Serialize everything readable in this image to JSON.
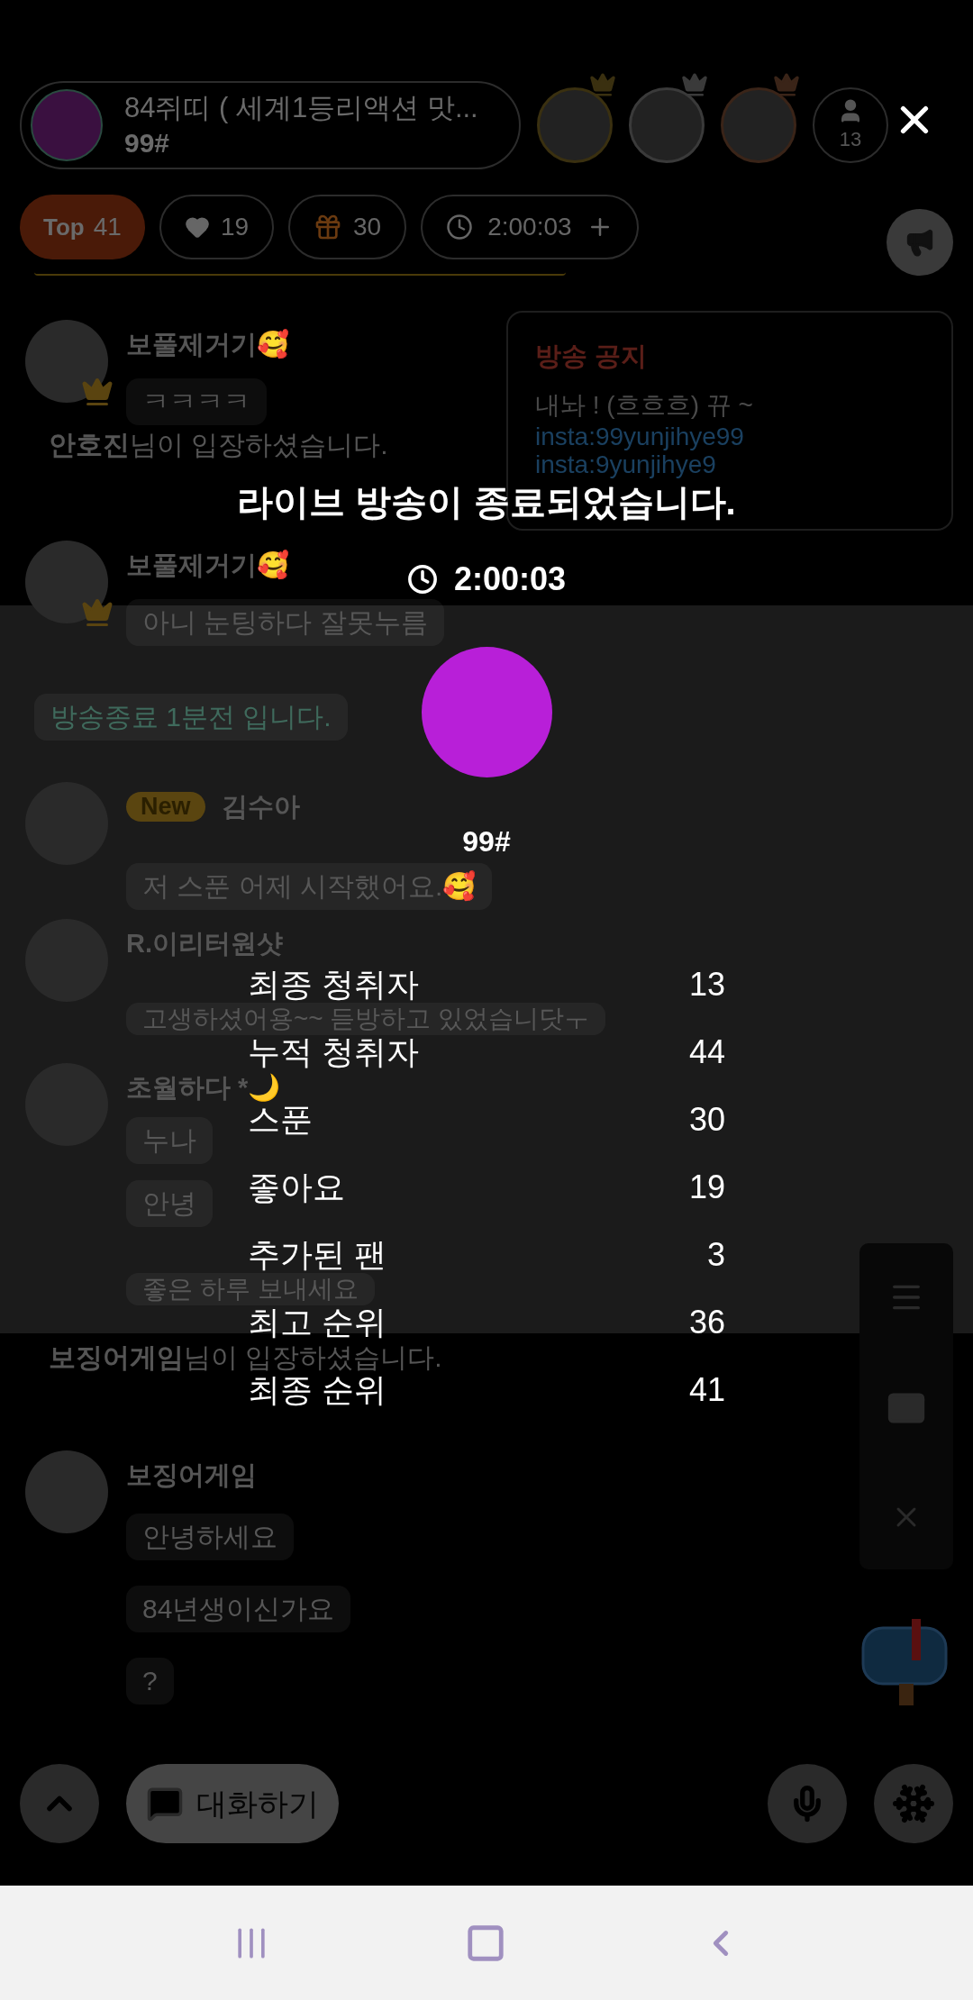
{
  "top_bar": {
    "host_title": "84쥐띠 ( 세계1등리액션 맛...",
    "host_name": "99#",
    "listener_count": "13"
  },
  "stat_chips": {
    "rank_label": "Top",
    "rank": "41",
    "likes": "19",
    "gifts": "30",
    "time": "2:00:03"
  },
  "notice_popup": {
    "title": "방송 공지",
    "text": "내놔 ! (흐흐흐) 뀨 ~",
    "links": [
      "insta:99yunjihye99",
      "insta:9yunjihye9"
    ]
  },
  "chat": [
    {
      "kind": "message",
      "name": "보풀제거기🥰",
      "crown": true,
      "bubbles": [
        "ㅋㅋㅋㅋ"
      ]
    },
    {
      "kind": "join",
      "text": "**안호진**님이 입장하셨습니다."
    },
    {
      "kind": "message",
      "name": "보풀제거기🥰",
      "crown": true,
      "bubbles": [
        "아니 눈팅하다 잘못누름"
      ]
    },
    {
      "kind": "notice",
      "text": "방송종료 1분전 입니다."
    },
    {
      "kind": "message",
      "name": "김수아",
      "badge": "New",
      "crown": false,
      "bubbles": [
        "저 스푼 어제 시작했어요.🥰"
      ]
    },
    {
      "kind": "message",
      "name": "R.이리터원샷",
      "crown": false,
      "bubbles": [
        "고생하셨어용~~ 듣방하고 있었습니닷ㅜ"
      ]
    },
    {
      "kind": "message",
      "name": "초월하다 *🌙",
      "crown": false,
      "bubbles": [
        "누나",
        "안녕",
        "좋은 하루 보내세요"
      ]
    },
    {
      "kind": "join",
      "text": "**보징어게임**님이 입장하셨습니다."
    },
    {
      "kind": "message",
      "name": "보징어게임",
      "crown": false,
      "bubbles": [
        "안녕하세요",
        "84년생이신가요",
        "?"
      ]
    }
  ],
  "bottom_bar": {
    "chat_button": "대화하기"
  },
  "end_overlay": {
    "title": "라이브 방송이 종료되었습니다.",
    "duration": "2:00:03",
    "host_name": "99#",
    "stats": [
      {
        "label": "최종 청취자",
        "value": "13"
      },
      {
        "label": "누적 청취자",
        "value": "44"
      },
      {
        "label": "스푼",
        "value": "30"
      },
      {
        "label": "좋아요",
        "value": "19"
      },
      {
        "label": "추가된 팬",
        "value": "3"
      },
      {
        "label": "최고 순위",
        "value": "36"
      },
      {
        "label": "최종 순위",
        "value": "41"
      }
    ]
  }
}
